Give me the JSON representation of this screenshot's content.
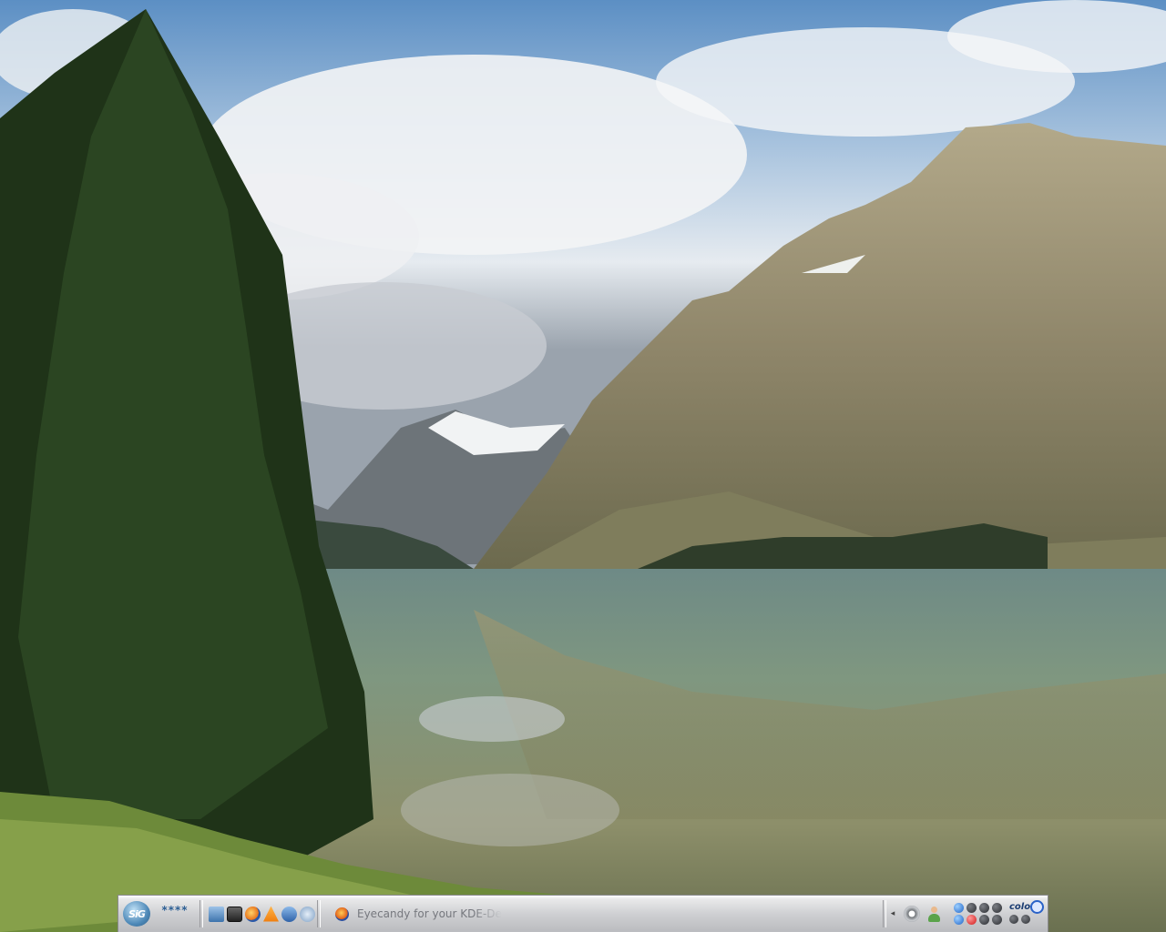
{
  "desktop": {
    "wallpaper": "mountain-lake-landscape"
  },
  "panel": {
    "kmenu_label": "KMenu",
    "kmenu_logo_text": "SiG",
    "pager_text": "****",
    "quicklaunch": [
      {
        "name": "home-folder-icon"
      },
      {
        "name": "terminal-icon"
      },
      {
        "name": "firefox-icon"
      },
      {
        "name": "vlc-icon"
      },
      {
        "name": "office-icon"
      },
      {
        "name": "settings-icon"
      }
    ],
    "tasks": [
      {
        "label": "Eyecandy for your KDE-De",
        "icon": "firefox-icon"
      }
    ],
    "tray": {
      "expand_arrow": "◂",
      "clock_label": "color"
    }
  },
  "colors": {
    "panel_bg": "#cfd0d3",
    "accent_blue": "#2d5f94",
    "tray_blue": "#1e63c7",
    "tray_red": "#d01818"
  }
}
